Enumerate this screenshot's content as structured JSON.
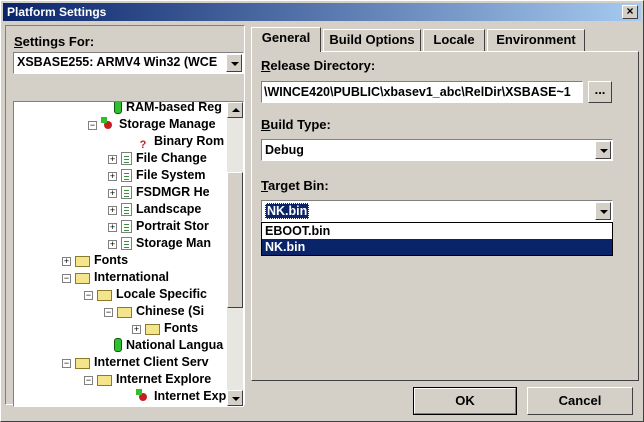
{
  "window": {
    "title": "Platform Settings",
    "close_glyph": "×"
  },
  "left": {
    "settings_for_label": "Settings For:",
    "settings_for_value": "XSBASE255: ARMV4 Win32 (WCE",
    "tree": [
      {
        "label": "RAM-based Reg",
        "icon": "registry-icon",
        "expander": ""
      },
      {
        "label": "Storage Manage",
        "icon": "storage-icon",
        "expander": "−"
      },
      {
        "label": "Binary Rom",
        "icon": "unknown-icon",
        "expander": ""
      },
      {
        "label": "File Change",
        "icon": "document-icon",
        "expander": "+"
      },
      {
        "label": "File System",
        "icon": "document-icon",
        "expander": "+"
      },
      {
        "label": "FSDMGR He",
        "icon": "document-icon",
        "expander": "+"
      },
      {
        "label": "Landscape",
        "icon": "document-icon",
        "expander": "+"
      },
      {
        "label": "Portrait Stor",
        "icon": "document-icon",
        "expander": "+"
      },
      {
        "label": "Storage Man",
        "icon": "document-icon",
        "expander": "+"
      },
      {
        "label": "Fonts",
        "icon": "folder-icon",
        "expander": "+"
      },
      {
        "label": "International",
        "icon": "folder-icon",
        "expander": "−"
      },
      {
        "label": "Locale Specific",
        "icon": "folder-icon",
        "expander": "−"
      },
      {
        "label": "Chinese (Si",
        "icon": "folder-icon",
        "expander": "−"
      },
      {
        "label": "Fonts",
        "icon": "folder-icon",
        "expander": "+"
      },
      {
        "label": "National Langua",
        "icon": "registry-icon",
        "expander": ""
      },
      {
        "label": "Internet Client Serv",
        "icon": "folder-icon",
        "expander": "−"
      },
      {
        "label": "Internet Explore",
        "icon": "folder-icon",
        "expander": "−"
      },
      {
        "label": "Internet Exp",
        "icon": "storage-icon",
        "expander": ""
      }
    ]
  },
  "tabs": [
    {
      "label": "General",
      "active": true
    },
    {
      "label": "Build Options",
      "active": false
    },
    {
      "label": "Locale",
      "active": false
    },
    {
      "label": "Environment",
      "active": false
    }
  ],
  "general": {
    "release_dir_label_u": "R",
    "release_dir_label_rest": "elease Directory:",
    "release_dir_value": "\\WINCE420\\PUBLIC\\xbasev1_abc\\RelDir\\XSBASE~1",
    "browse_label": "...",
    "build_type_label_u": "B",
    "build_type_label_rest": "uild Type:",
    "build_type_value": "Debug",
    "target_bin_label_u": "T",
    "target_bin_label_rest": "arget Bin:",
    "target_bin_value": "NK.bin",
    "target_bin_options": [
      "EBOOT.bin",
      "NK.bin"
    ],
    "target_bin_selected": "NK.bin"
  },
  "footer": {
    "ok_label": "OK",
    "cancel_label": "Cancel"
  },
  "colors": {
    "selection": "#0a246a",
    "face": "#d4d0c8"
  }
}
